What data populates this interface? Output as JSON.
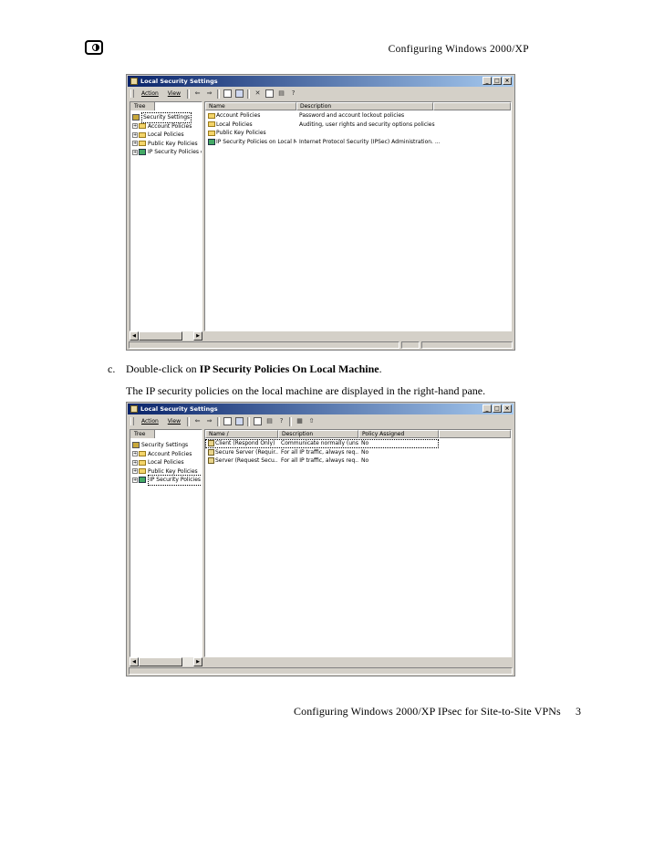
{
  "header": {
    "title": "Configuring Windows 2000/XP"
  },
  "window_title": "Local Security Settings",
  "menus": [
    "Action",
    "View"
  ],
  "tree_tab": "Tree",
  "tree_items": [
    "Security Settings",
    "Account Policies",
    "Local Policies",
    "Public Key Policies",
    "IP Security Policies on Local Machine"
  ],
  "window1": {
    "columns": [
      "Name",
      "Description"
    ],
    "rows": [
      {
        "name": "Account Policies",
        "description": "Password and account lockout policies"
      },
      {
        "name": "Local Policies",
        "description": "Auditing, user rights and security options policies"
      },
      {
        "name": "Public Key Policies",
        "description": ""
      },
      {
        "name": "IP Security Policies on Local M...",
        "description": "Internet Protocol Security (IPSec) Administration. ..."
      }
    ]
  },
  "step": {
    "letter": "c.",
    "prefix": "Double-click on ",
    "bold": "IP Security Policies On Local Machine",
    "suffix": "."
  },
  "paragraph": "The IP security policies on the local machine are displayed in the right-hand pane.",
  "window2": {
    "columns": [
      "Name  /",
      "Description",
      "Policy Assigned"
    ],
    "rows": [
      {
        "name": "Client (Respond Only)",
        "description": "Communicate normally (uns...",
        "assigned": "No"
      },
      {
        "name": "Secure Server (Requir...",
        "description": "For all IP traffic, always req...",
        "assigned": "No"
      },
      {
        "name": "Server (Request Secu...",
        "description": "For all IP traffic, always req...",
        "assigned": "No"
      }
    ]
  },
  "footer": {
    "text": "Configuring Windows 2000/XP IPsec for Site-to-Site VPNs",
    "page": "3"
  }
}
